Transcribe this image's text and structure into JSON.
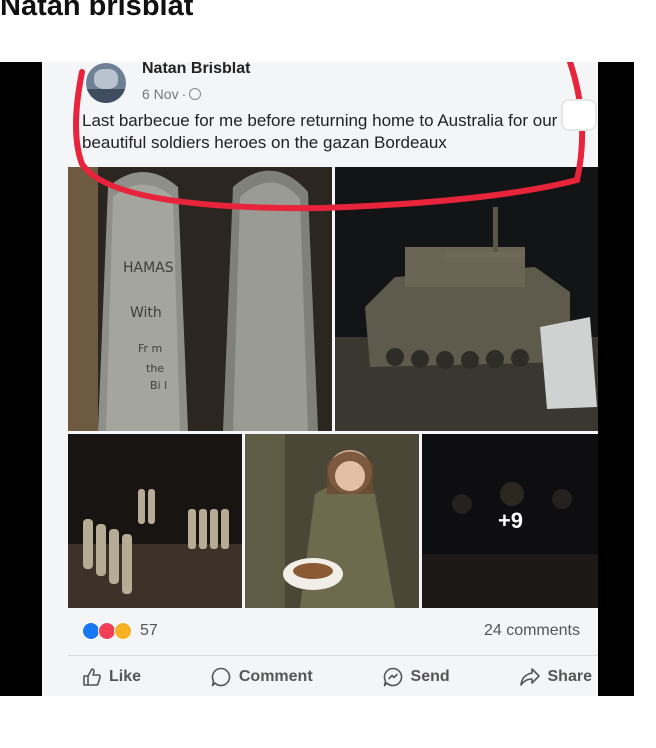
{
  "page": {
    "heading": "Natan brisblat"
  },
  "post": {
    "author": "Natan Brisblat",
    "date": "6 Nov",
    "separator": "·",
    "privacy_icon": "globe-icon",
    "text": "Last barbecue for me before returning home to Australia for our beautiful soldiers heroes on the gazan Bordeaux",
    "highlight_color": "#e8233c",
    "photos": [
      {
        "description": "artillery-shells-with-writing",
        "writing": [
          "HAMAS",
          "With",
          "Fr m",
          "the",
          "Bi   l"
        ]
      },
      {
        "description": "tank-at-night"
      },
      {
        "description": "stacked-shells-at-night"
      },
      {
        "description": "soldier-with-plate"
      },
      {
        "description": "night-scene",
        "overlay": "+9"
      }
    ],
    "reactions": {
      "icons": [
        "like-reaction-icon",
        "love-reaction-icon",
        "haha-reaction-icon"
      ],
      "count": "57"
    },
    "comments": "24 comments",
    "actions": {
      "like": "Like",
      "comment": "Comment",
      "send": "Send",
      "share": "Share"
    }
  }
}
